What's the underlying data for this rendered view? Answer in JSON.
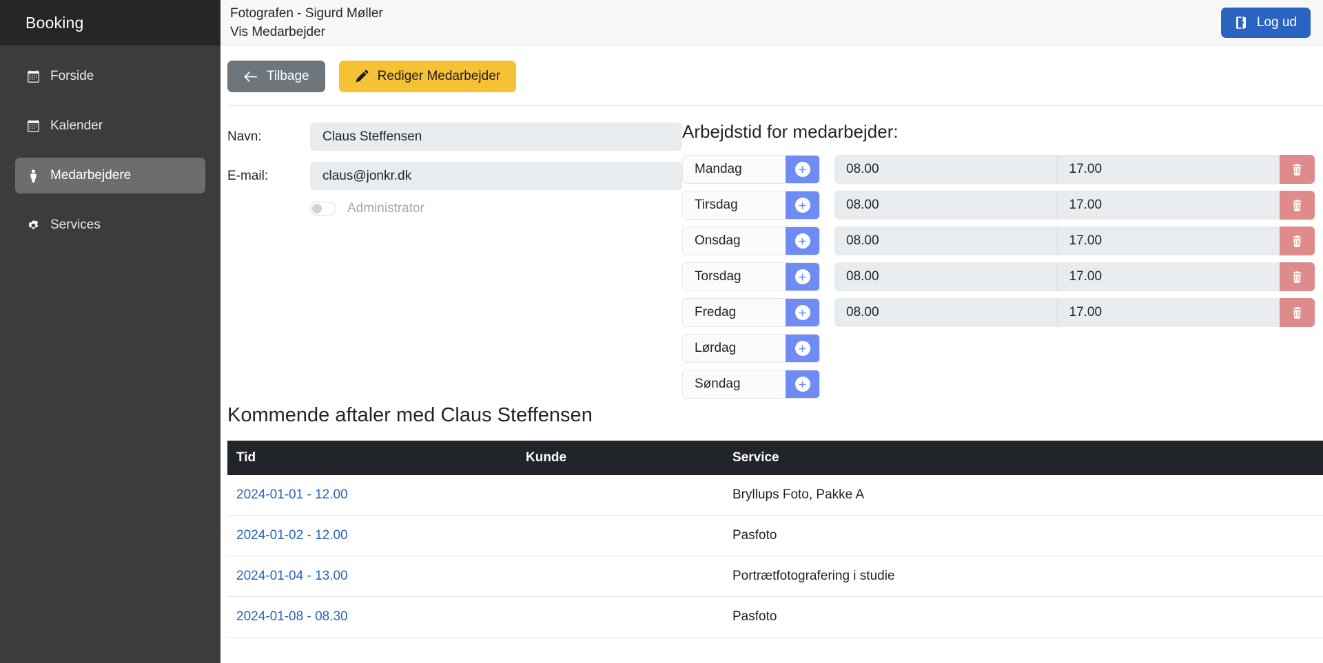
{
  "sidebar": {
    "brand": "Booking",
    "items": [
      {
        "label": "Forside",
        "icon": "calendar-icon",
        "active": false
      },
      {
        "label": "Kalender",
        "icon": "calendar-icon",
        "active": false
      },
      {
        "label": "Medarbejdere",
        "icon": "person-icon",
        "active": true
      },
      {
        "label": "Services",
        "icon": "gear-icon",
        "active": false
      }
    ]
  },
  "topbar": {
    "line1": "Fotografen - Sigurd Møller",
    "line2": "Vis Medarbejder",
    "logout_label": "Log ud",
    "logout_icon": "sign-out-icon",
    "logout_color": "#2a63c0"
  },
  "toolbar": {
    "back_label": "Tilbage",
    "back_icon": "arrow-left-icon",
    "edit_label": "Rediger Medarbejder",
    "edit_icon": "pencil-icon",
    "edit_color": "#f5c236"
  },
  "employee": {
    "name_label": "Navn:",
    "name_value": "Claus Steffensen",
    "email_label": "E-mail:",
    "email_value": "claus@jonkr.dk",
    "admin_label": "Administrator",
    "admin_checked": false
  },
  "hours": {
    "heading": "Arbejdstid for medarbejder:",
    "add_icon": "plus-icon",
    "delete_icon": "trash-icon",
    "add_color": "#6e8cf3",
    "delete_color": "#e08b8b",
    "rows": [
      {
        "day": "Mandag",
        "start": "08.00",
        "end": "17.00",
        "has_time": true
      },
      {
        "day": "Tirsdag",
        "start": "08.00",
        "end": "17.00",
        "has_time": true
      },
      {
        "day": "Onsdag",
        "start": "08.00",
        "end": "17.00",
        "has_time": true
      },
      {
        "day": "Torsdag",
        "start": "08.00",
        "end": "17.00",
        "has_time": true
      },
      {
        "day": "Fredag",
        "start": "08.00",
        "end": "17.00",
        "has_time": true
      },
      {
        "day": "Lørdag",
        "start": "",
        "end": "",
        "has_time": false
      },
      {
        "day": "Søndag",
        "start": "",
        "end": "",
        "has_time": false
      }
    ]
  },
  "appointments": {
    "title": "Kommende aftaler med Claus Steffensen",
    "columns": [
      "Tid",
      "Kunde",
      "Service"
    ],
    "rows": [
      {
        "tid": "2024-01-01 - 12.00",
        "kunde": "",
        "service": "Bryllups Foto, Pakke A"
      },
      {
        "tid": "2024-01-02 - 12.00",
        "kunde": "",
        "service": "Pasfoto"
      },
      {
        "tid": "2024-01-04 - 13.00",
        "kunde": "",
        "service": "Portrætfotografering i studie"
      },
      {
        "tid": "2024-01-08 - 08.30",
        "kunde": "",
        "service": "Pasfoto"
      }
    ]
  }
}
